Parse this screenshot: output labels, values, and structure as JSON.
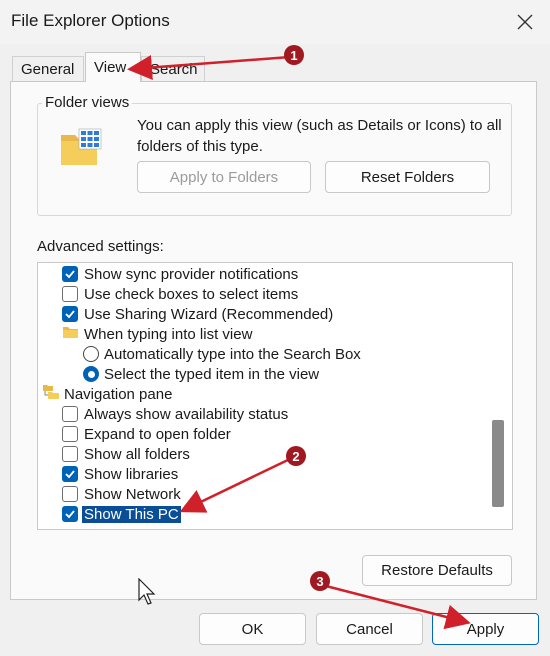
{
  "window": {
    "title": "File Explorer Options"
  },
  "tabs": [
    {
      "label": "General"
    },
    {
      "label": "View"
    },
    {
      "label": "Search"
    }
  ],
  "folder_views": {
    "label": "Folder views",
    "description": "You can apply this view (such as Details or Icons) to all folders of this type.",
    "apply_button": "Apply to Folders",
    "reset_button": "Reset Folders"
  },
  "advanced": {
    "label": "Advanced settings:",
    "items": [
      {
        "type": "checkbox",
        "checked": true,
        "label": "Show sync provider notifications"
      },
      {
        "type": "checkbox",
        "checked": false,
        "label": "Use check boxes to select items"
      },
      {
        "type": "checkbox",
        "checked": true,
        "label": "Use Sharing Wizard (Recommended)"
      },
      {
        "type": "folder",
        "label": "When typing into list view"
      },
      {
        "type": "radio",
        "checked": false,
        "label": "Automatically type into the Search Box"
      },
      {
        "type": "radio",
        "checked": true,
        "label": "Select the typed item in the view"
      },
      {
        "type": "nav",
        "label": "Navigation pane"
      },
      {
        "type": "checkbox",
        "checked": false,
        "label": "Always show availability status"
      },
      {
        "type": "checkbox",
        "checked": false,
        "label": "Expand to open folder"
      },
      {
        "type": "checkbox",
        "checked": false,
        "label": "Show all folders"
      },
      {
        "type": "checkbox",
        "checked": true,
        "label": "Show libraries"
      },
      {
        "type": "checkbox",
        "checked": false,
        "label": "Show Network"
      },
      {
        "type": "checkbox",
        "checked": true,
        "label": "Show This PC"
      }
    ],
    "restore_button": "Restore Defaults"
  },
  "footer": {
    "ok": "OK",
    "cancel": "Cancel",
    "apply": "Apply"
  },
  "annotations": [
    "1",
    "2",
    "3"
  ],
  "colors": {
    "annotation": "#a01820",
    "accent": "#0062b4",
    "selection": "#0a4e97"
  }
}
